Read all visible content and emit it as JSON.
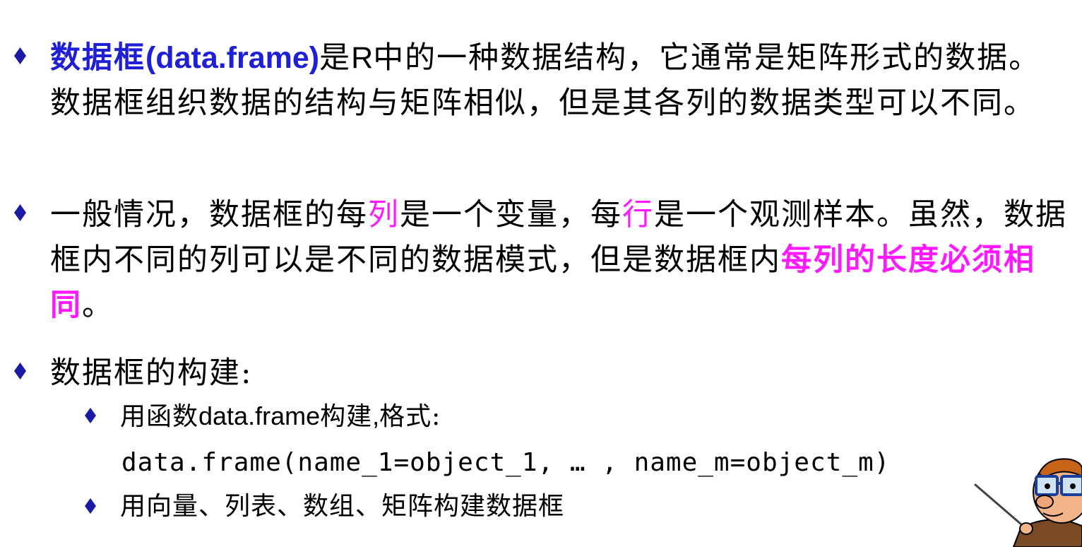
{
  "bullets": {
    "b1": {
      "highlight_cn": "数据框",
      "highlight_en": "(data.frame)",
      "text_a": "是",
      "letter_r": "R",
      "text_b": "中的一种数据结构，它通常是矩阵形式的数据。数据框组织数据的结构与矩阵相似，但是其各列的数据类型可以不同。"
    },
    "b2": {
      "text_a": "一般情况，数据框的每",
      "hl_col": "列",
      "text_b": "是一个变量，每",
      "hl_row": "行",
      "text_c": "是一个观测样本。虽然，数据框内不同的列可以是不同的数据模式，但是数据框内",
      "hl_end": "每列的长度必须相同",
      "text_d": "。"
    },
    "b3": {
      "text": "数据框的构建:"
    },
    "sub1": {
      "text_a": "用函数",
      "latin": "data.frame",
      "text_b": "构建",
      "comma": ",",
      "text_c": "格式:"
    },
    "code": "data.frame(name_1=object_1, … , name_m=object_m)",
    "sub2": {
      "text": "用向量、列表、数组、矩阵构建数据框"
    }
  },
  "colors": {
    "bullet": "#1a1aa6",
    "title_blue": "#1f1fd6",
    "emphasis_magenta": "#ff19ff"
  },
  "icons": [
    "diamond-bullet-icon",
    "professor-mascot-icon"
  ]
}
